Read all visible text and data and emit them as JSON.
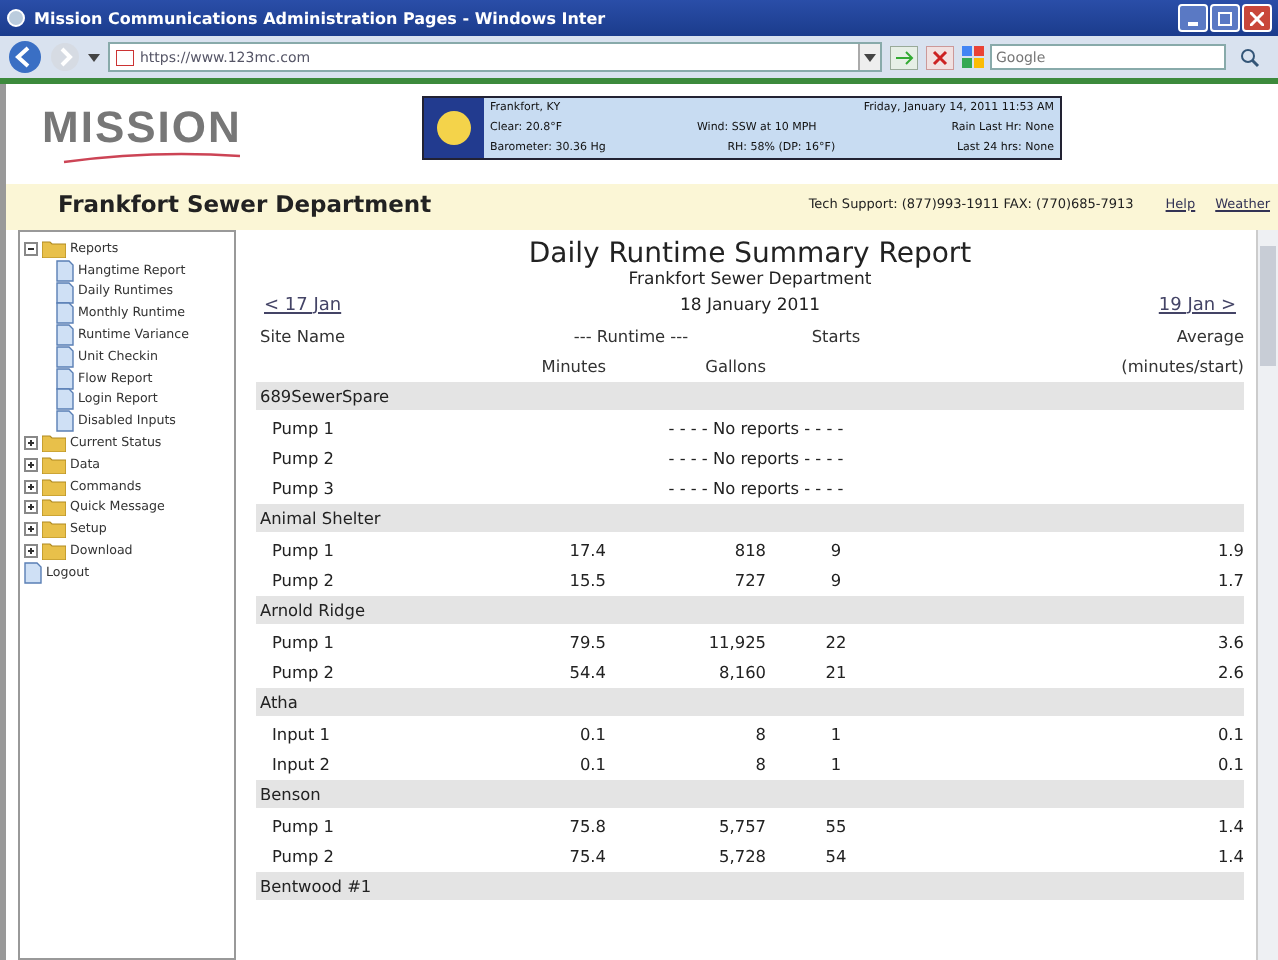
{
  "window": {
    "title": "Mission Communications Administration Pages - Windows Inter"
  },
  "logo": "MISSION",
  "browser": {
    "address": "https://www.123mc.com",
    "search_placeholder": "Google"
  },
  "weather": {
    "location": "Frankfort, KY",
    "date": "Friday, January 14, 2011 11:53 AM",
    "lines": [
      [
        "Clear: 20.8°F",
        "Wind: SSW at 10 MPH",
        "Rain Last Hr: None"
      ],
      [
        "Barometer: 30.36 Hg",
        "RH: 58% (DP: 16°F)",
        "Last 24 hrs: None"
      ]
    ]
  },
  "header": {
    "department": "Frankfort Sewer Department",
    "support": "Tech Support: (877)993-1911 FAX: (770)685-7913",
    "links": [
      "Help",
      "Weather"
    ]
  },
  "sidebar": {
    "items": [
      {
        "label": "Reports",
        "kind": "folder",
        "expanded": true,
        "children": [
          {
            "label": "Hangtime Report",
            "kind": "page"
          },
          {
            "label": "Daily Runtimes",
            "kind": "page"
          },
          {
            "label": "Monthly Runtime",
            "kind": "page"
          },
          {
            "label": "Runtime Variance",
            "kind": "page"
          },
          {
            "label": "Unit Checkin",
            "kind": "page"
          },
          {
            "label": "Flow Report",
            "kind": "page"
          },
          {
            "label": "Login Report",
            "kind": "page"
          },
          {
            "label": "Disabled Inputs",
            "kind": "page"
          }
        ]
      },
      {
        "label": "Current Status",
        "kind": "folder",
        "expanded": false
      },
      {
        "label": "Data",
        "kind": "folder",
        "expanded": false
      },
      {
        "label": "Commands",
        "kind": "folder",
        "expanded": false
      },
      {
        "label": "Quick Message",
        "kind": "folder",
        "expanded": false
      },
      {
        "label": "Setup",
        "kind": "folder",
        "expanded": false
      },
      {
        "label": "Download",
        "kind": "folder",
        "expanded": false
      },
      {
        "label": "Logout",
        "kind": "page"
      }
    ]
  },
  "report": {
    "title": "Daily Runtime Summary Report",
    "subtitle": "Frankfort Sewer Department",
    "date": "18 January 2011",
    "prev": "< 17 Jan",
    "next": "19 Jan >",
    "columns": {
      "site": "Site Name",
      "runtime": "--- Runtime ---",
      "starts": "Starts",
      "average": "Average",
      "minutes": "Minutes",
      "gallons": "Gallons",
      "average_unit": "(minutes/start)"
    },
    "sections": [
      {
        "site": "689SewerSpare",
        "rows": [
          {
            "name": "Pump 1",
            "kind": "message",
            "message": "- - - - No reports - - - -"
          },
          {
            "name": "Pump 2",
            "kind": "message",
            "message": "- - - - No reports - - - -"
          },
          {
            "name": "Pump 3",
            "kind": "message",
            "message": "- - - - No reports - - - -"
          }
        ]
      },
      {
        "site": "Animal Shelter",
        "rows": [
          {
            "name": "Pump 1",
            "kind": "data",
            "minutes": "17.4",
            "gallons": "818",
            "starts": "9",
            "average": "1.9"
          },
          {
            "name": "Pump 2",
            "kind": "data",
            "minutes": "15.5",
            "gallons": "727",
            "starts": "9",
            "average": "1.7"
          }
        ]
      },
      {
        "site": "Arnold Ridge",
        "rows": [
          {
            "name": "Pump 1",
            "kind": "data",
            "minutes": "79.5",
            "gallons": "11,925",
            "starts": "22",
            "average": "3.6"
          },
          {
            "name": "Pump 2",
            "kind": "data",
            "minutes": "54.4",
            "gallons": "8,160",
            "starts": "21",
            "average": "2.6"
          }
        ]
      },
      {
        "site": "Atha",
        "rows": [
          {
            "name": "Input 1",
            "kind": "data",
            "minutes": "0.1",
            "gallons": "8",
            "starts": "1",
            "average": "0.1"
          },
          {
            "name": "Input 2",
            "kind": "data",
            "minutes": "0.1",
            "gallons": "8",
            "starts": "1",
            "average": "0.1"
          }
        ]
      },
      {
        "site": "Benson",
        "rows": [
          {
            "name": "Pump 1",
            "kind": "data",
            "minutes": "75.8",
            "gallons": "5,757",
            "starts": "55",
            "average": "1.4"
          },
          {
            "name": "Pump 2",
            "kind": "data",
            "minutes": "75.4",
            "gallons": "5,728",
            "starts": "54",
            "average": "1.4"
          }
        ]
      },
      {
        "site": "Bentwood #1"
      }
    ]
  }
}
